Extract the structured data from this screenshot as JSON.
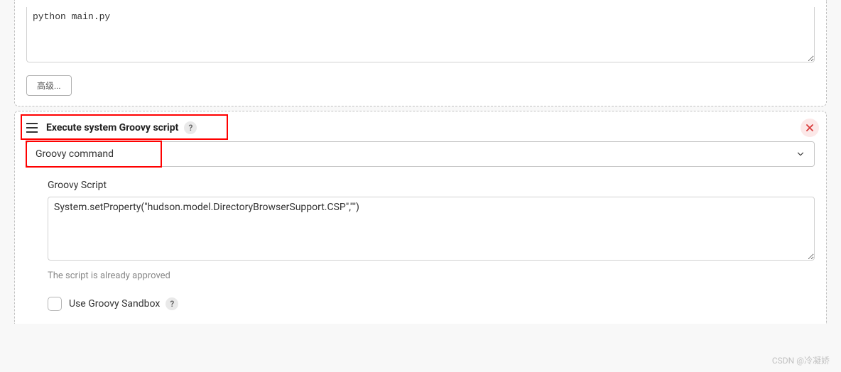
{
  "top_panel": {
    "command_value": "python main.py",
    "advanced_btn": "高级..."
  },
  "groovy_section": {
    "title": "Execute system Groovy script",
    "help": "?",
    "select_value": "Groovy command",
    "script_label": "Groovy Script",
    "script_value": "System.setProperty(\"hudson.model.DirectoryBrowserSupport.CSP\",\"\")",
    "approved_text": "The script is already approved",
    "sandbox_label": "Use Groovy Sandbox",
    "sandbox_help": "?"
  },
  "watermark": "CSDN @冷凝娇"
}
